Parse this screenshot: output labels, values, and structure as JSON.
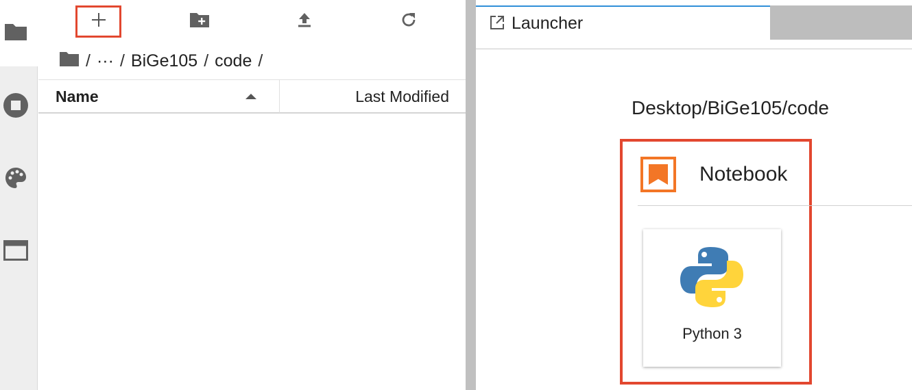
{
  "browser": {
    "toolbar": {
      "new_launcher_icon": "plus-icon",
      "new_folder_icon": "new-folder-icon",
      "upload_icon": "upload-icon",
      "refresh_icon": "refresh-icon"
    },
    "breadcrumb": {
      "sep1": "/",
      "ellipsis": "···",
      "sep2": "/",
      "folder1": "BiGe105",
      "sep3": "/",
      "folder2": "code",
      "sep4": "/"
    },
    "columns": {
      "name": "Name",
      "last_modified": "Last Modified"
    }
  },
  "main": {
    "tab": {
      "label": "Launcher"
    },
    "launcher": {
      "cwd": "Desktop/BiGe105/code",
      "section_title": "Notebook",
      "kernels": [
        {
          "label": "Python 3"
        }
      ]
    }
  },
  "colors": {
    "highlight": "#e2472f",
    "notebook_orange": "#f37626",
    "tab_accent": "#2f8fd8",
    "python_blue": "#3f7cb4",
    "python_yellow": "#ffd43b"
  }
}
